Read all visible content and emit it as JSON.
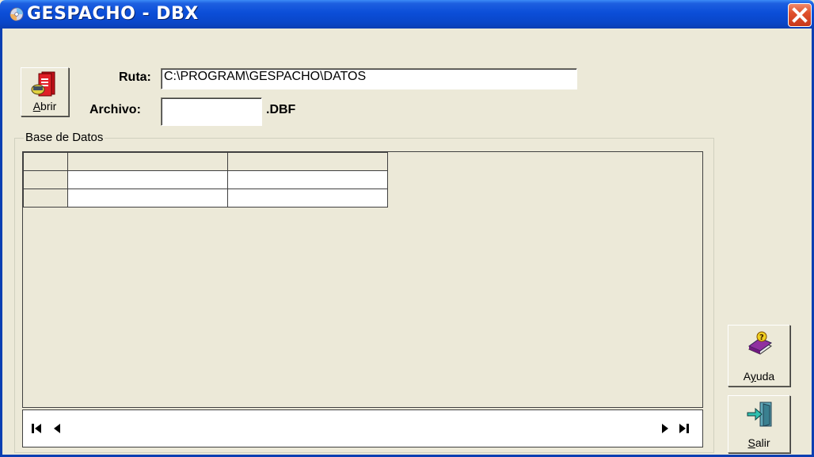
{
  "window": {
    "title": "GESPACHO - DBX"
  },
  "toolbar": {
    "open_label_u": "A",
    "open_label_rest": "brir"
  },
  "form": {
    "ruta_label": "Ruta:",
    "ruta_value": "C:\\PROGRAM\\GESPACHO\\DATOS",
    "archivo_label": "Archivo:",
    "archivo_value": "",
    "extension": ".DBF"
  },
  "group": {
    "title": "Base de Datos"
  },
  "grid": {
    "columns": [
      "",
      ""
    ],
    "rows": [
      [
        "",
        ""
      ],
      [
        "",
        ""
      ]
    ]
  },
  "side_buttons": {
    "help_pre": "A",
    "help_u": "y",
    "help_post": "uda",
    "exit_u": "S",
    "exit_rest": "alir"
  },
  "icons": {
    "app": "cd-icon",
    "close": "close-icon",
    "open": "book-open-icon",
    "help": "help-book-icon",
    "exit": "exit-door-icon",
    "nav": [
      "first-record-icon",
      "prev-record-icon",
      "next-record-icon",
      "last-record-icon"
    ]
  },
  "colors": {
    "titlebar": "#0b4ed8",
    "close": "#e0512c",
    "face": "#ece9d8"
  }
}
